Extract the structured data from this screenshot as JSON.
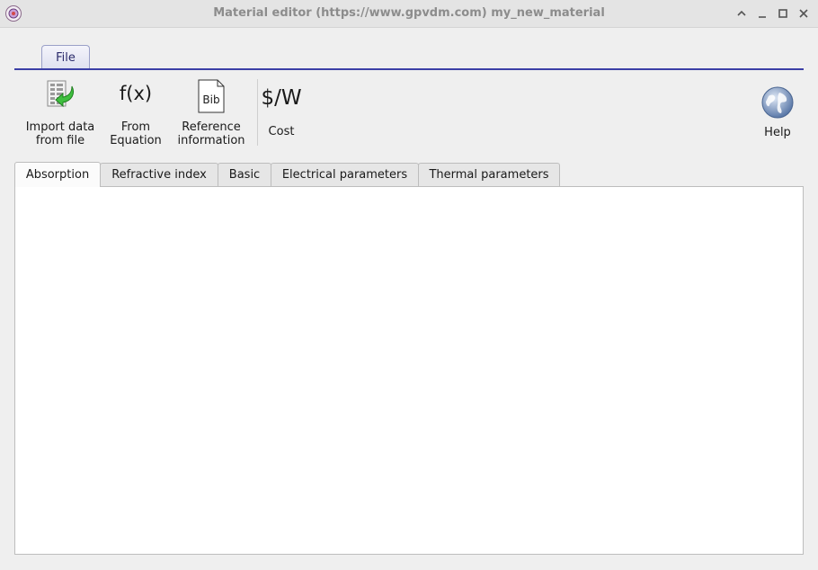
{
  "window": {
    "title": "Material editor (https://www.gpvdm.com) my_new_material",
    "app_icon": "gpvdm-logo-icon",
    "controls": [
      "chevron-up-icon",
      "minimize-icon",
      "maximize-icon",
      "close-icon"
    ]
  },
  "ribbon": {
    "file_tab": "File",
    "accent_color": "#3b3fa6"
  },
  "toolbar": {
    "import_line1": "Import data",
    "import_line2": "from file",
    "equation_symbol": "f(x)",
    "equation_line1": "From",
    "equation_line2": "Equation",
    "bib_badge": "Bib",
    "reference_line1": "Reference",
    "reference_line2": "information",
    "cost_symbol": "$/W",
    "cost_label": "Cost",
    "help_label": "Help"
  },
  "tabs": {
    "absorption": "Absorption",
    "refractive": "Refractive index",
    "basic": "Basic",
    "electrical": "Electrical parameters",
    "thermal": "Thermal parameters",
    "selected": "Absorption"
  }
}
